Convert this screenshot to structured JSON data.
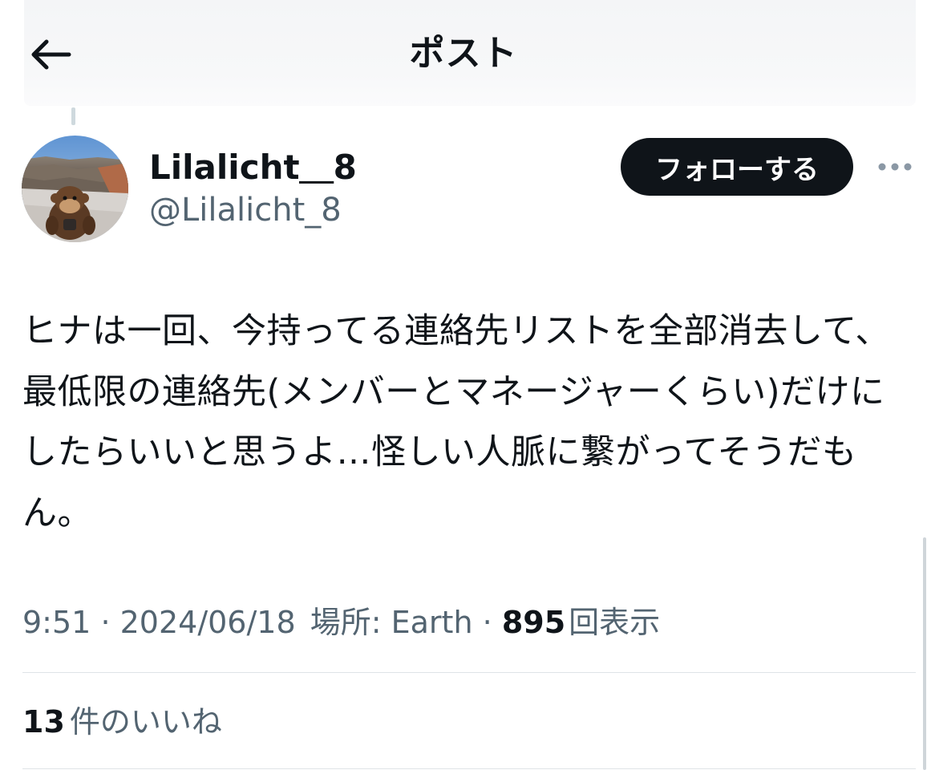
{
  "header": {
    "title": "ポスト",
    "back_icon": "arrow-left-icon"
  },
  "author": {
    "display_name": "Lilalicht＿8",
    "handle": "@Lilalicht_8",
    "avatar": "avatar-monkey-canyon"
  },
  "follow_button": {
    "label": "フォローする"
  },
  "more_icon": "more-dots-icon",
  "post": {
    "text": "ヒナは一回、今持ってる連絡先リストを全部消去して、最低限の連絡先(メンバーとマネージャーくらい)だけにしたらいいと思うよ…怪しい人脈に繋がってそうだもん。"
  },
  "meta": {
    "time": "9:51",
    "separator": "·",
    "date": "2024/06/18",
    "location_label": "場所: Earth",
    "views_count": "895",
    "views_label": "回表示"
  },
  "engagement": {
    "likes_count": "13",
    "likes_label": "件のいいね"
  },
  "colors": {
    "text_primary": "#0f1419",
    "text_secondary": "#536471",
    "divider": "#dfe4e7",
    "button_bg": "#0f1419"
  }
}
